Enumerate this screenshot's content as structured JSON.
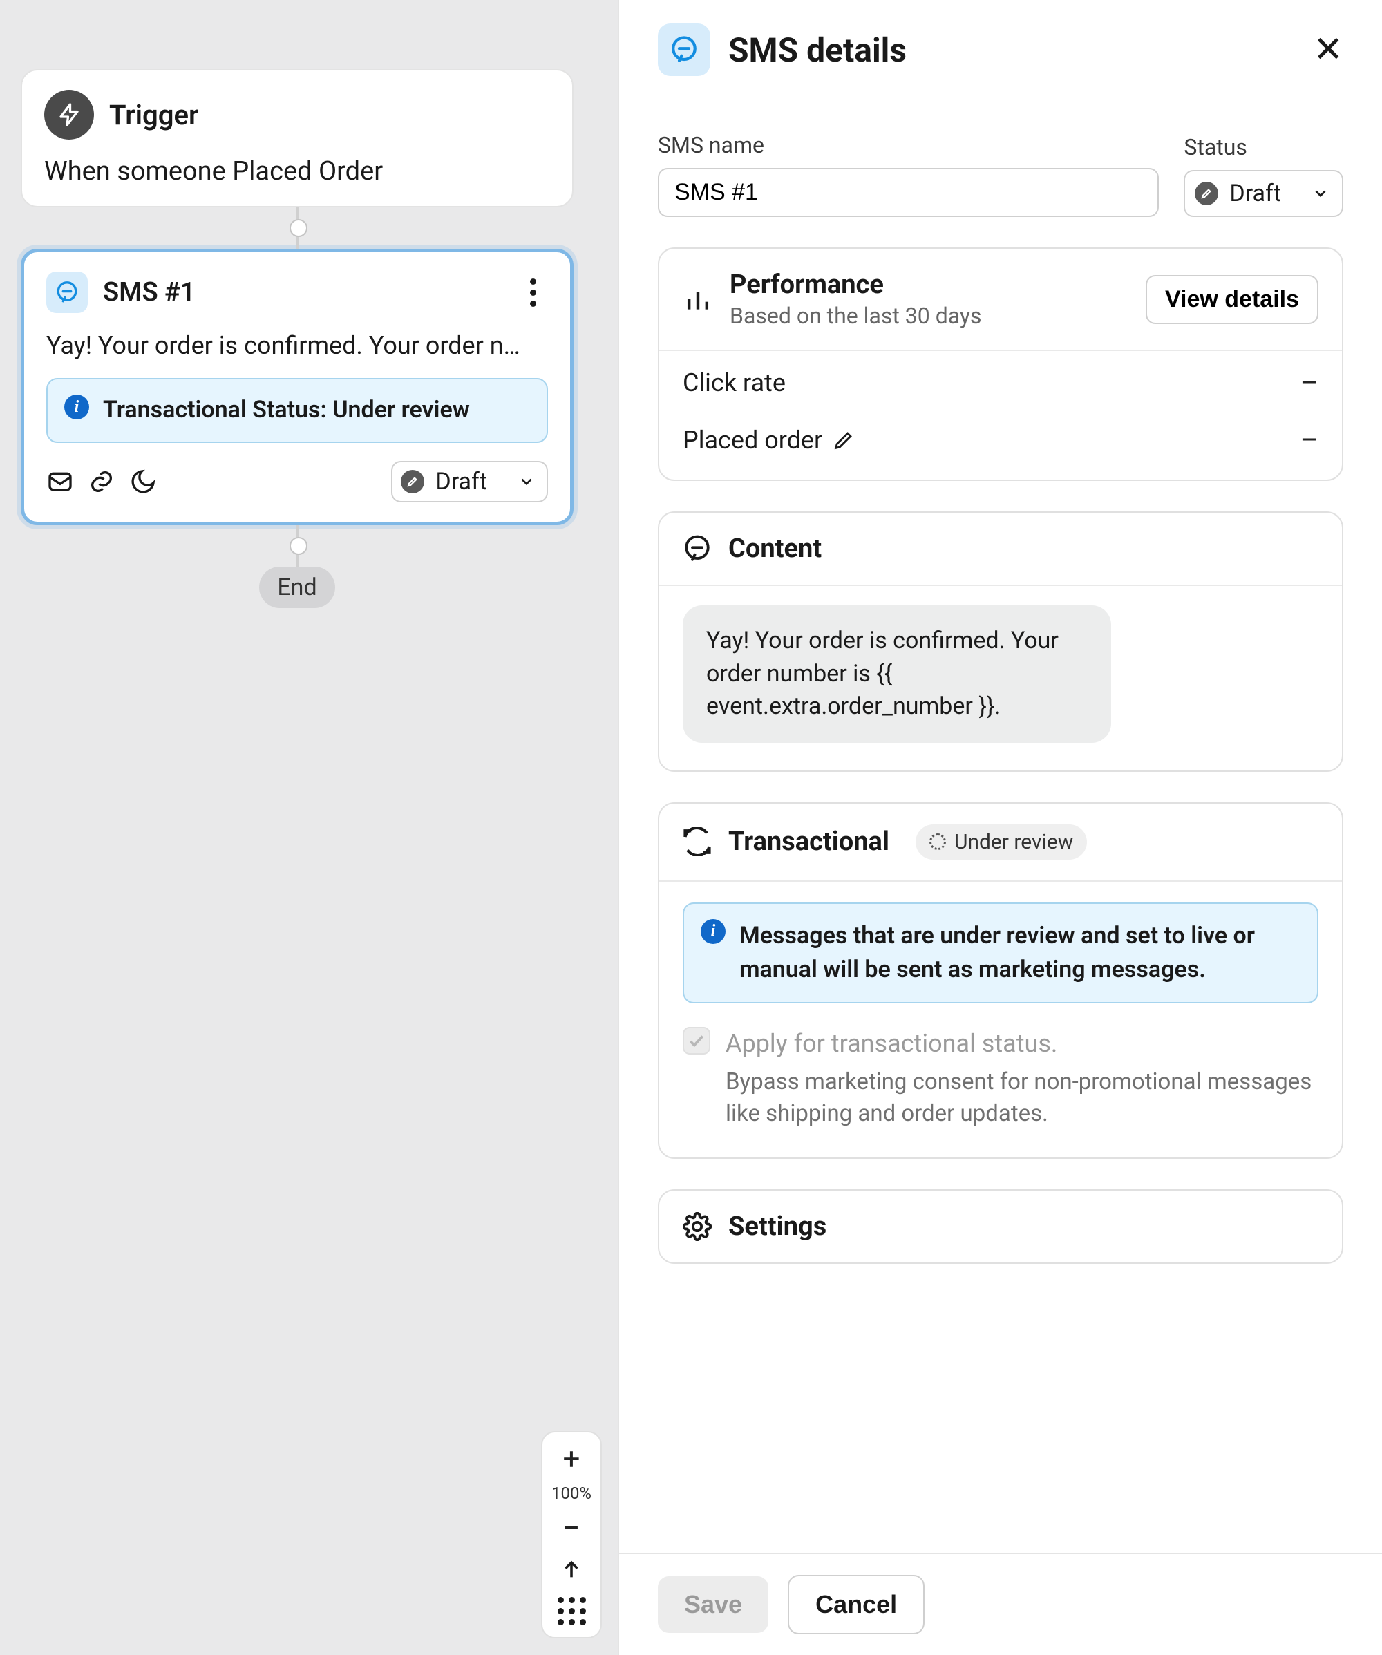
{
  "canvas": {
    "trigger": {
      "title": "Trigger",
      "desc": "When someone Placed Order"
    },
    "sms_node": {
      "title": "SMS #1",
      "preview": "Yay! Your order is confirmed. Your order n…",
      "callout": "Transactional Status: Under review",
      "status_label": "Draft"
    },
    "end_label": "End",
    "zoom_pct": "100%"
  },
  "panel": {
    "title": "SMS details",
    "name_label": "SMS name",
    "name_value": "SMS #1",
    "status_label": "Status",
    "status_value": "Draft",
    "performance": {
      "title": "Performance",
      "subtitle": "Based on the last 30 days",
      "view_details": "View details",
      "metrics": [
        {
          "label": "Click rate",
          "value": "–"
        },
        {
          "label": "Placed order",
          "value": "–"
        }
      ]
    },
    "content": {
      "title": "Content",
      "body": "Yay! Your order is confirmed. Your order number is {{ event.extra.order_number }}."
    },
    "transactional": {
      "title": "Transactional",
      "badge": "Under review",
      "callout": "Messages that are under review and set to live or manual will be sent as marketing messages.",
      "apply_label": "Apply for transactional status.",
      "apply_sub": "Bypass marketing consent for non-promotional messages like shipping and order updates."
    },
    "settings": {
      "title": "Settings"
    },
    "footer": {
      "save": "Save",
      "cancel": "Cancel"
    }
  }
}
